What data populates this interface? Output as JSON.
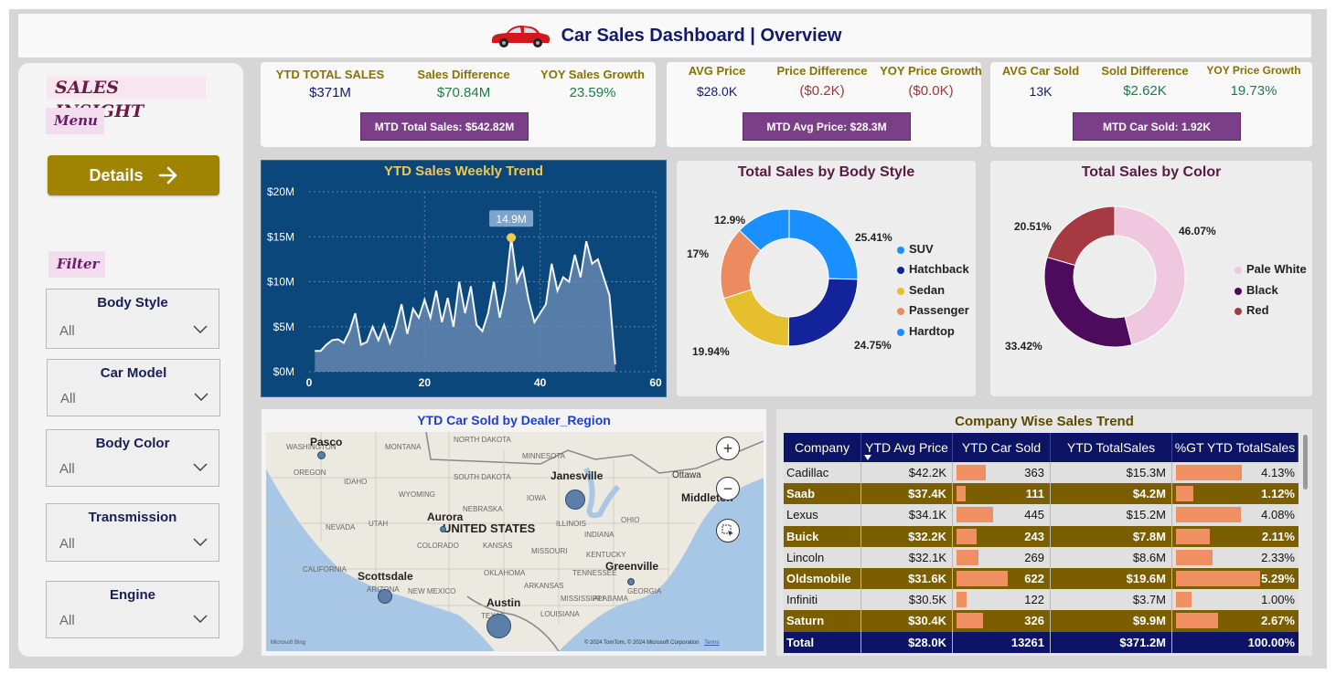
{
  "header": {
    "title": "Car Sales Dashboard | Overview",
    "icon": "red-car-icon"
  },
  "sidebar": {
    "sales_insight": "SALES INSIGHT",
    "menu_label": "Menu",
    "details_button": "Details",
    "filter_label": "Filter",
    "slicers": [
      {
        "title": "Body Style",
        "value": "All"
      },
      {
        "title": "Car Model",
        "value": "All"
      },
      {
        "title": "Body Color",
        "value": "All"
      },
      {
        "title": "Transmission",
        "value": "All"
      },
      {
        "title": "Engine",
        "value": "All"
      }
    ]
  },
  "kpis": {
    "sales": {
      "total_label": "YTD TOTAL SALES",
      "total_value": "$371M",
      "diff_label": "Sales Difference",
      "diff_value": "$70.84M",
      "growth_label": "YOY Sales Growth",
      "growth_value": "23.59%",
      "mtd": "MTD Total Sales: $542.82M"
    },
    "price": {
      "avg_label": "AVG Price",
      "avg_value": "$28.0K",
      "diff_label": "Price Difference",
      "diff_value": "($0.2K)",
      "growth_label": "YOY Price Growth",
      "growth_value": "($0.0K)",
      "mtd": "MTD Avg Price: $28.3M"
    },
    "sold": {
      "avg_label": "AVG Car Sold",
      "avg_value": "13K",
      "diff_label": "Sold Difference",
      "diff_value": "$2.62K",
      "growth_label": "YOY Price Growth",
      "growth_value": "19.73%",
      "mtd": "MTD Car Sold: 1.92K"
    }
  },
  "colors": {
    "gold": "#a08300",
    "purple": "#7b3f8a",
    "navy": "#0d1466",
    "green": "#1f7a4a",
    "red_text": "#a0363a",
    "trend_bg": "#0c477c",
    "bar": "#ef8f62"
  },
  "chart_data": [
    {
      "type": "area",
      "title": "YTD Sales Weekly Trend",
      "x_ticks": [
        "0",
        "20",
        "40",
        "60"
      ],
      "y_ticks": [
        "$0M",
        "$5M",
        "$10M",
        "$15M",
        "$20M"
      ],
      "xlim": [
        0,
        60
      ],
      "ylim": [
        0,
        20
      ],
      "tooltip": "14.9M",
      "x": [
        1,
        2,
        3,
        4,
        5,
        6,
        7,
        8,
        9,
        10,
        11,
        12,
        13,
        14,
        15,
        16,
        17,
        18,
        19,
        20,
        21,
        22,
        23,
        24,
        25,
        26,
        27,
        28,
        29,
        30,
        31,
        32,
        33,
        34,
        35,
        36,
        37,
        38,
        39,
        40,
        41,
        42,
        43,
        44,
        45,
        46,
        47,
        48,
        49,
        50,
        51,
        52,
        53
      ],
      "values": [
        2.3,
        2.3,
        3.0,
        3.5,
        3.6,
        3.2,
        4.5,
        6.5,
        3.0,
        3.3,
        5.0,
        3.5,
        5.2,
        3.2,
        5.0,
        7.5,
        4.2,
        7.0,
        6.0,
        8.0,
        6.0,
        9.0,
        5.5,
        8.2,
        5.0,
        10.0,
        6.5,
        9.5,
        5.2,
        4.5,
        6.5,
        10.0,
        6.0,
        9.0,
        14.9,
        10.0,
        11.5,
        8.0,
        5.5,
        6.5,
        7.5,
        12.0,
        9.0,
        10.5,
        10.0,
        13.0,
        10.5,
        14.5,
        12.0,
        12.5,
        10.5,
        8.5,
        0.8
      ]
    },
    {
      "type": "pie",
      "title": "Total Sales by Body Style",
      "categories": [
        "SUV",
        "Hatchback",
        "Sedan",
        "Passenger",
        "Hardtop"
      ],
      "values": [
        25.41,
        24.75,
        19.94,
        17,
        12.9
      ],
      "labels": [
        "25.41%",
        "24.75%",
        "19.94%",
        "17%",
        "12.9%"
      ],
      "colors": [
        "#1a8fff",
        "#13239a",
        "#e5bf2e",
        "#ec8a60",
        "#1a8fff"
      ]
    },
    {
      "type": "pie",
      "title": "Total Sales by Color",
      "categories": [
        "Pale White",
        "Black",
        "Red"
      ],
      "values": [
        46.07,
        33.42,
        20.51
      ],
      "labels": [
        "46.07%",
        "33.42%",
        "20.51%"
      ],
      "colors": [
        "#efc8df",
        "#4e0a5c",
        "#a53a43"
      ]
    }
  ],
  "map": {
    "title": "YTD Car Sold by Dealer_Region",
    "country_label": "UNITED STATES",
    "cities": [
      {
        "name": "Pasco"
      },
      {
        "name": "Janesville"
      },
      {
        "name": "Aurora"
      },
      {
        "name": "Middleton"
      },
      {
        "name": "Scottsdale"
      },
      {
        "name": "Greenville"
      },
      {
        "name": "Austin"
      }
    ],
    "state_labels": [
      "WASHINGTON",
      "MONTANA",
      "NORTH DAKOTA",
      "MINNESOTA",
      "OREGON",
      "SOUTH DAKOTA",
      "IDAHO",
      "WYOMING",
      "IOWA",
      "NEBRASKA",
      "NEVADA",
      "UTAH",
      "COLORADO",
      "KANSAS",
      "MISSOURI",
      "ILLINOIS",
      "INDIANA",
      "OHIO",
      "CALIFORNIA",
      "ARIZONA",
      "NEW MEXICO",
      "OKLAHOMA",
      "ARKANSAS",
      "TENNESSEE",
      "KENTUCKY",
      "TEXAS",
      "LOUISIANA",
      "MISSISSIPPI",
      "ALABAMA",
      "GEORGIA",
      "Ottawa"
    ],
    "attribution": "© 2024 TomTom, © 2024 Microsoft Corporation",
    "terms": "Terms",
    "brand": "Microsoft Bing"
  },
  "table": {
    "title": "Company Wise Sales Trend",
    "columns": [
      "Company",
      "YTD Avg Price",
      "YTD Car Sold",
      "YTD TotalSales",
      "%GT YTD TotalSales"
    ],
    "rows": [
      {
        "company": "Cadillac",
        "avg_price": "$42.2K",
        "sold": "363",
        "sales": "$15.3M",
        "pct": "4.13%",
        "sold_frac": 0.58,
        "pct_frac": 0.78,
        "style": "light"
      },
      {
        "company": "Saab",
        "avg_price": "$37.4K",
        "sold": "111",
        "sales": "$4.2M",
        "pct": "1.12%",
        "sold_frac": 0.18,
        "pct_frac": 0.21,
        "style": "gold"
      },
      {
        "company": "Lexus",
        "avg_price": "$34.1K",
        "sold": "445",
        "sales": "$15.2M",
        "pct": "4.08%",
        "sold_frac": 0.72,
        "pct_frac": 0.77,
        "style": "light"
      },
      {
        "company": "Buick",
        "avg_price": "$32.2K",
        "sold": "243",
        "sales": "$7.8M",
        "pct": "2.11%",
        "sold_frac": 0.39,
        "pct_frac": 0.4,
        "style": "gold"
      },
      {
        "company": "Lincoln",
        "avg_price": "$32.1K",
        "sold": "269",
        "sales": "$8.6M",
        "pct": "2.33%",
        "sold_frac": 0.43,
        "pct_frac": 0.44,
        "style": "light"
      },
      {
        "company": "Oldsmobile",
        "avg_price": "$31.6K",
        "sold": "622",
        "sales": "$19.6M",
        "pct": "5.29%",
        "sold_frac": 1.0,
        "pct_frac": 1.0,
        "style": "gold"
      },
      {
        "company": "Infiniti",
        "avg_price": "$30.5K",
        "sold": "122",
        "sales": "$3.7M",
        "pct": "1.00%",
        "sold_frac": 0.2,
        "pct_frac": 0.19,
        "style": "light"
      },
      {
        "company": "Saturn",
        "avg_price": "$30.4K",
        "sold": "326",
        "sales": "$9.9M",
        "pct": "2.67%",
        "sold_frac": 0.52,
        "pct_frac": 0.5,
        "style": "gold"
      }
    ],
    "total": {
      "company": "Total",
      "avg_price": "$28.0K",
      "sold": "13261",
      "sales": "$371.2M",
      "pct": "100.00%"
    }
  }
}
